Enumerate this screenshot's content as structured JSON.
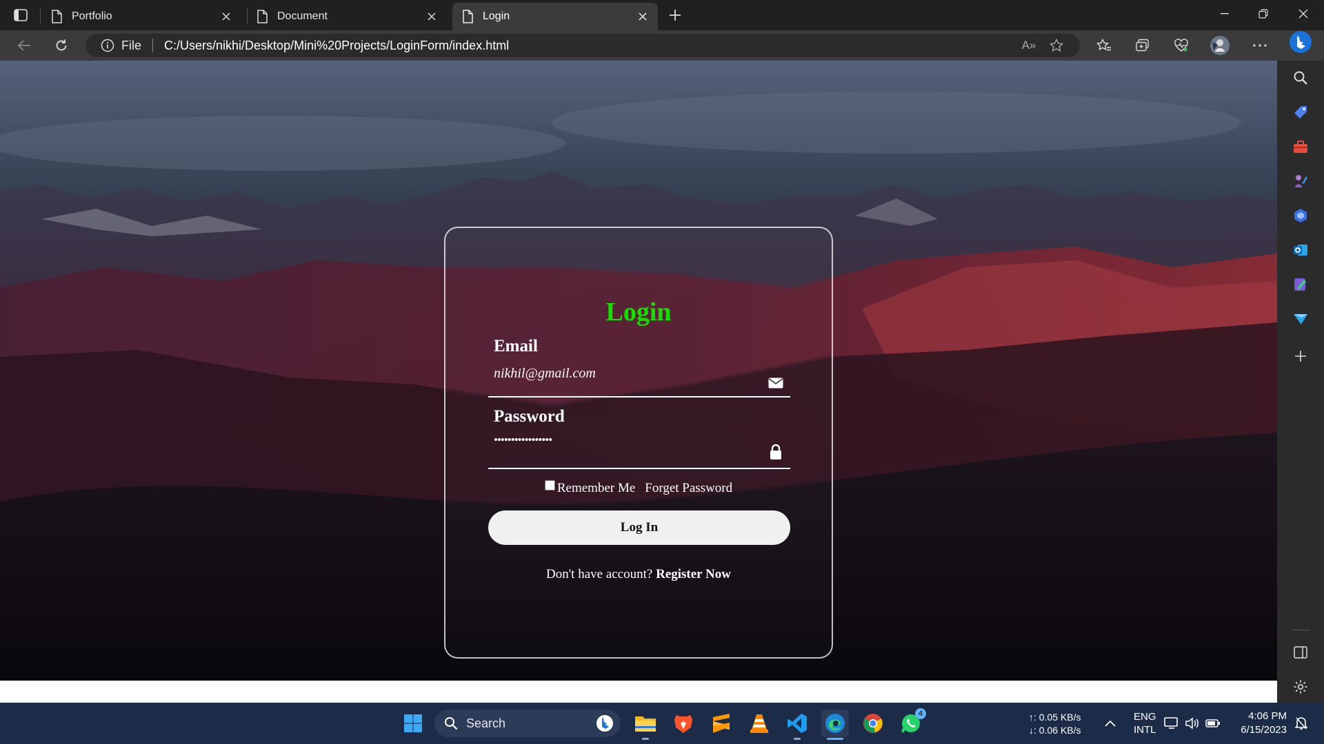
{
  "browser": {
    "tabs": [
      {
        "title": "Portfolio",
        "active": false
      },
      {
        "title": "Document",
        "active": false
      },
      {
        "title": "Login",
        "active": true
      }
    ],
    "address": {
      "scheme": "File",
      "url": "C:/Users/nikhi/Desktop/Mini%20Projects/LoginForm/index.html"
    },
    "read_aloud_label": "A»"
  },
  "login": {
    "title": "Login",
    "title_color": "#13e000",
    "email_label": "Email",
    "email_value": "nikhil@gmail.com",
    "password_label": "Password",
    "password_value": "•••••••••••••••••",
    "remember_label": "Remember Me",
    "remember_checked": false,
    "forget_label": "Forget Password",
    "button_label": "Log In",
    "register_prompt": "Don't have account?",
    "register_link": "Register Now"
  },
  "taskbar": {
    "search_label": "Search",
    "net_up": "↑: 0.05 KB/s",
    "net_down": "↓: 0.06 KB/s",
    "lang_1": "ENG",
    "lang_2": "INTL",
    "time": "4:06 PM",
    "date": "6/15/2023",
    "whatsapp_badge": "4"
  }
}
